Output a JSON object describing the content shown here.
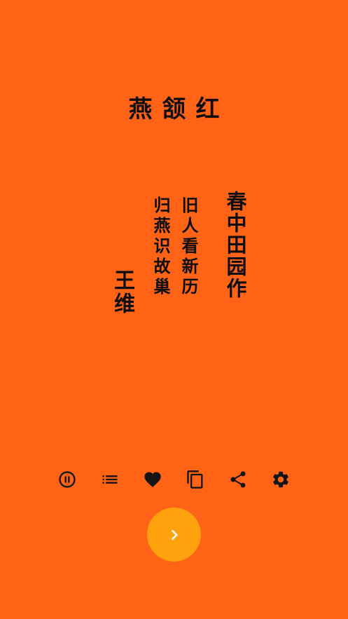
{
  "colors": {
    "background": "#ff6416",
    "accent_button": "#ffa20e",
    "text": "#0d0d0d",
    "icon": "#141414"
  },
  "color_name": "燕颔红",
  "poem": {
    "title": "春中田园作",
    "lines": [
      "旧人看新历",
      "归燕识故巢"
    ],
    "author": "王维"
  },
  "toolbar": {
    "icons": [
      "pause-circle-icon",
      "list-icon",
      "heart-icon",
      "copy-icon",
      "share-icon",
      "gear-icon"
    ]
  },
  "next_button": {
    "icon": "chevron-right-icon"
  }
}
